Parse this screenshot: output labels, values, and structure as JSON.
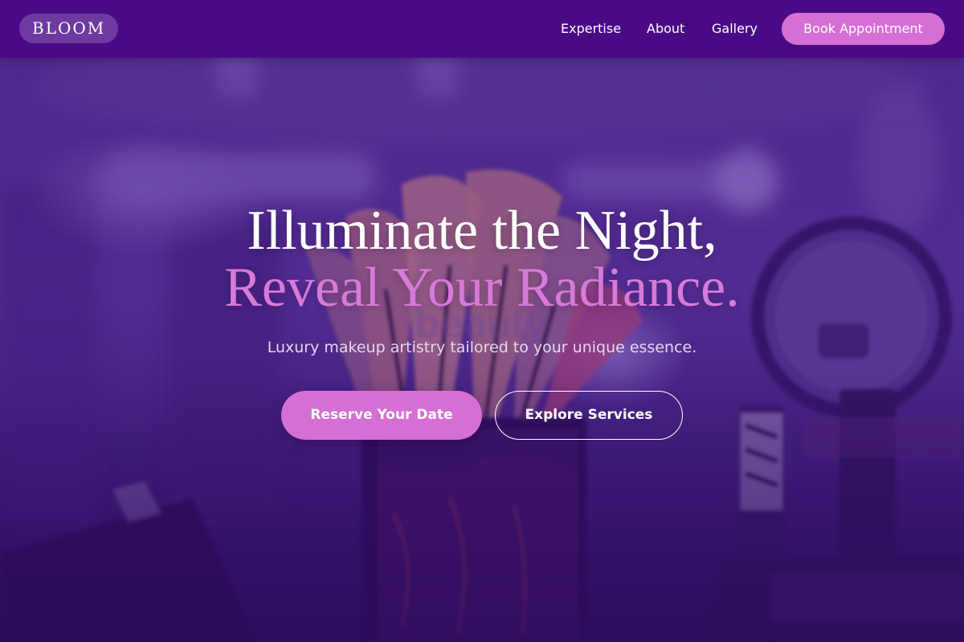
{
  "header": {
    "logo": "BLOOM",
    "nav": [
      "Expertise",
      "About",
      "Gallery"
    ],
    "cta_label": "Book Appointment"
  },
  "hero": {
    "title_line1": "Illuminate the Night,",
    "title_line2": "Reveal Your Radiance.",
    "subtitle": "Luxury makeup artistry tailored to your unique essence.",
    "primary_cta": "Reserve Your Date",
    "secondary_cta": "Explore Services"
  },
  "colors": {
    "header_bg": "#4a0a86",
    "accent": "#d56fd3",
    "overlay": "#3a1570"
  }
}
